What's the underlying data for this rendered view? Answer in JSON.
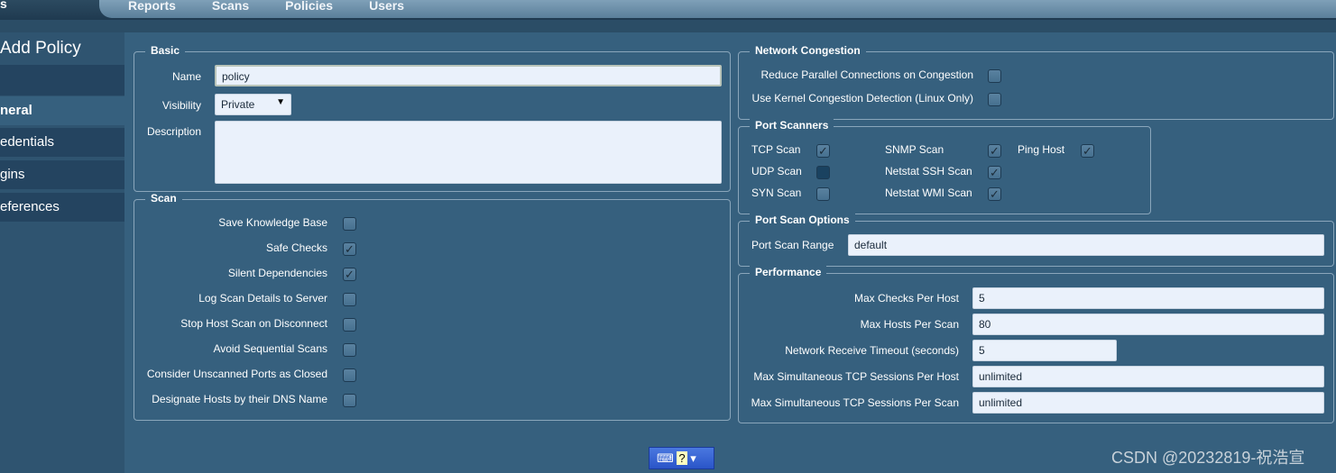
{
  "nav": {
    "brand": "s",
    "tabs": [
      "Reports",
      "Scans",
      "Policies",
      "Users"
    ]
  },
  "page_title": "Add Policy",
  "sidebar": {
    "items": [
      "",
      "neral",
      "edentials",
      "gins",
      "eferences"
    ],
    "active": 1
  },
  "basic": {
    "legend": "Basic",
    "name_label": "Name",
    "name_value": "policy",
    "visibility_label": "Visibility",
    "visibility_value": "Private",
    "description_label": "Description",
    "description_value": ""
  },
  "scan": {
    "legend": "Scan",
    "items": [
      {
        "label": "Save Knowledge Base",
        "checked": false
      },
      {
        "label": "Safe Checks",
        "checked": true
      },
      {
        "label": "Silent Dependencies",
        "checked": true
      },
      {
        "label": "Log Scan Details to Server",
        "checked": false
      },
      {
        "label": "Stop Host Scan on Disconnect",
        "checked": false
      },
      {
        "label": "Avoid Sequential Scans",
        "checked": false
      },
      {
        "label": "Consider Unscanned Ports as Closed",
        "checked": false
      },
      {
        "label": "Designate Hosts by their DNS Name",
        "checked": false
      }
    ]
  },
  "network_congestion": {
    "legend": "Network Congestion",
    "items": [
      {
        "label": "Reduce Parallel Connections on Congestion",
        "checked": false
      },
      {
        "label": "Use Kernel Congestion Detection (Linux Only)",
        "checked": false
      }
    ]
  },
  "port_scanners": {
    "legend": "Port Scanners",
    "items": [
      {
        "label": "TCP Scan",
        "checked": true
      },
      {
        "label": "UDP Scan",
        "checked": false
      },
      {
        "label": "SYN Scan",
        "checked": false
      },
      {
        "label": "SNMP Scan",
        "checked": true
      },
      {
        "label": "Netstat SSH Scan",
        "checked": true
      },
      {
        "label": "Netstat WMI Scan",
        "checked": true
      },
      {
        "label": "Ping Host",
        "checked": true
      }
    ]
  },
  "port_scan_options": {
    "legend": "Port Scan Options",
    "range_label": "Port Scan Range",
    "range_value": "default"
  },
  "performance": {
    "legend": "Performance",
    "items": [
      {
        "label": "Max Checks Per Host",
        "value": "5"
      },
      {
        "label": "Max Hosts Per Scan",
        "value": "80"
      },
      {
        "label": "Network Receive Timeout (seconds)",
        "value": "5"
      },
      {
        "label": "Max Simultaneous TCP Sessions Per Host",
        "value": "unlimited"
      },
      {
        "label": "Max Simultaneous TCP Sessions Per Scan",
        "value": "unlimited"
      }
    ]
  },
  "watermark": "CSDN @20232819-祝浩宣",
  "check_mark": "✓"
}
